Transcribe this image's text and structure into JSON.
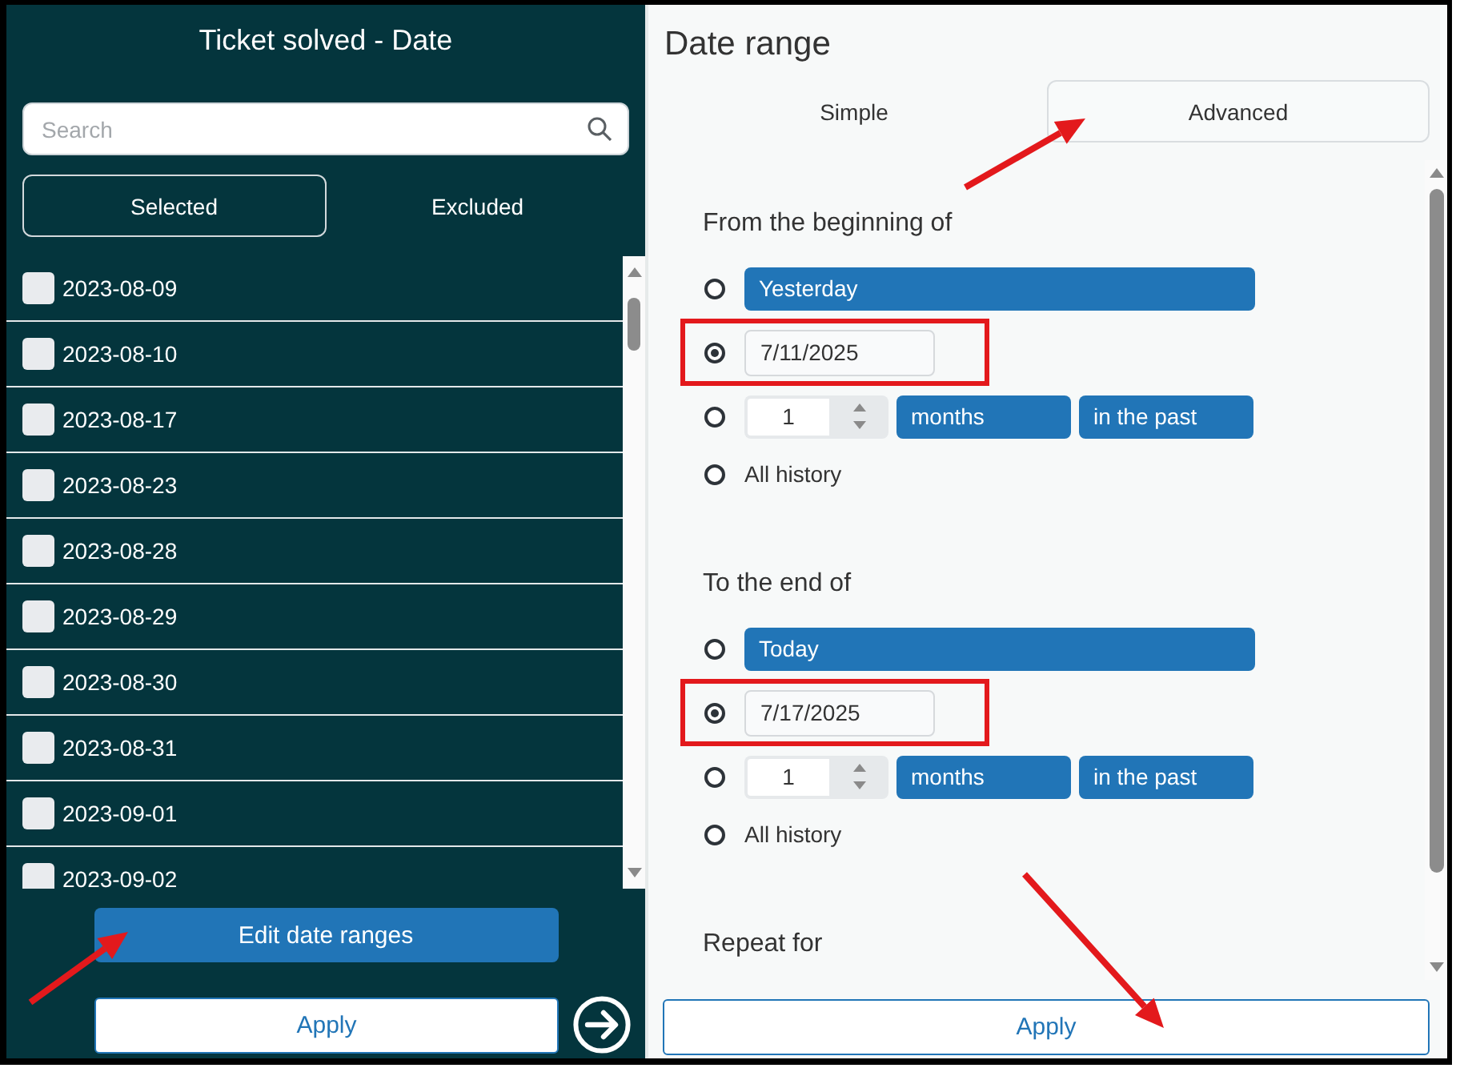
{
  "filter_panel": {
    "title": "Ticket solved - Date",
    "search": {
      "placeholder": "Search"
    },
    "modes": [
      {
        "label": "Selected",
        "selected": true
      },
      {
        "label": "Excluded",
        "selected": false
      }
    ],
    "items": [
      {
        "label": "2023-08-09",
        "checked": false
      },
      {
        "label": "2023-08-10",
        "checked": false
      },
      {
        "label": "2023-08-17",
        "checked": false
      },
      {
        "label": "2023-08-23",
        "checked": false
      },
      {
        "label": "2023-08-28",
        "checked": false
      },
      {
        "label": "2023-08-29",
        "checked": false
      },
      {
        "label": "2023-08-30",
        "checked": false
      },
      {
        "label": "2023-08-31",
        "checked": false
      },
      {
        "label": "2023-09-01",
        "checked": false
      },
      {
        "label": "2023-09-02",
        "checked": false
      }
    ],
    "edit_button": "Edit date ranges",
    "apply_button": "Apply"
  },
  "date_range": {
    "title": "Date range",
    "tabs": [
      {
        "label": "Simple",
        "selected": false
      },
      {
        "label": "Advanced",
        "selected": true
      }
    ],
    "sections": [
      {
        "heading": "From the beginning of",
        "options": [
          {
            "kind": "preset",
            "label": "Yesterday",
            "selected": false,
            "highlighted": false
          },
          {
            "kind": "date",
            "value": "7/11/2025",
            "selected": true,
            "highlighted": true
          },
          {
            "kind": "relative",
            "value": "1",
            "unit": "months",
            "direction": "in the past",
            "selected": false,
            "highlighted": false
          },
          {
            "kind": "label",
            "label": "All history",
            "selected": false,
            "highlighted": false
          }
        ]
      },
      {
        "heading": "To the end of",
        "options": [
          {
            "kind": "preset",
            "label": "Today",
            "selected": false,
            "highlighted": false
          },
          {
            "kind": "date",
            "value": "7/17/2025",
            "selected": true,
            "highlighted": true
          },
          {
            "kind": "relative",
            "value": "1",
            "unit": "months",
            "direction": "in the past",
            "selected": false,
            "highlighted": false
          },
          {
            "kind": "label",
            "label": "All history",
            "selected": false,
            "highlighted": false
          }
        ]
      },
      {
        "heading": "Repeat for"
      }
    ],
    "apply_button": "Apply"
  }
}
